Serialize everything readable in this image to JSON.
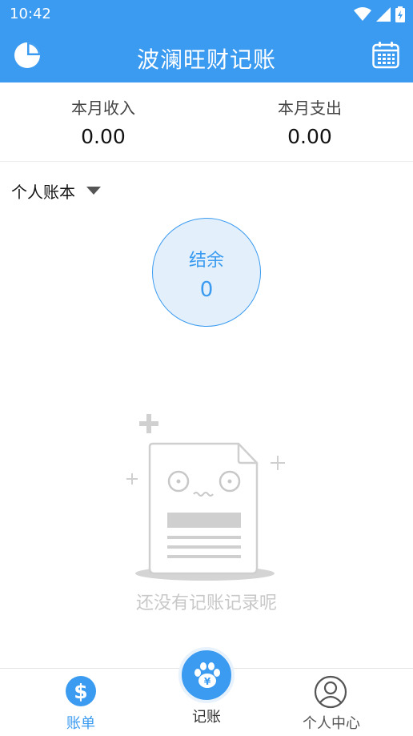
{
  "status_bar": {
    "time": "10:42"
  },
  "app_bar": {
    "title": "波澜旺财记账",
    "left_icon": "pie-chart-icon",
    "right_icon": "calendar-icon"
  },
  "summary": {
    "income_label": "本月收入",
    "income_value": "0.00",
    "expense_label": "本月支出",
    "expense_value": "0.00"
  },
  "ledger": {
    "name": "个人账本"
  },
  "balance": {
    "label": "结余",
    "value": "0"
  },
  "empty_state": {
    "text": "还没有记账记录呢"
  },
  "tab_bar": {
    "tabs": [
      {
        "label": "账单",
        "icon": "dollar-circle-icon",
        "active": true
      },
      {
        "label": "记账",
        "icon": "paw-yen-icon",
        "active": false
      },
      {
        "label": "个人中心",
        "icon": "user-circle-icon",
        "active": false
      }
    ]
  },
  "colors": {
    "primary": "#3b9bf0",
    "balance_fill": "#e3f0fc",
    "empty_text": "#c8c8c8"
  }
}
